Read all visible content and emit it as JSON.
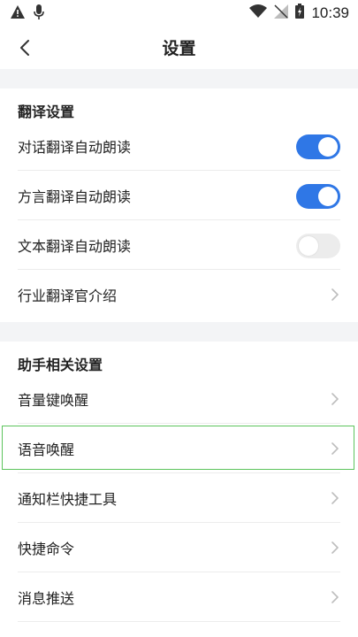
{
  "status_bar": {
    "time": "10:39",
    "icons": [
      "alert-icon",
      "mic-icon",
      "wifi-icon",
      "no-signal-icon",
      "battery-icon"
    ]
  },
  "header": {
    "title": "设置"
  },
  "translation_section": {
    "title": "翻译设置",
    "items": [
      {
        "label": "对话翻译自动朗读",
        "type": "toggle",
        "on": true
      },
      {
        "label": "方言翻译自动朗读",
        "type": "toggle",
        "on": true
      },
      {
        "label": "文本翻译自动朗读",
        "type": "toggle",
        "on": false
      },
      {
        "label": "行业翻译官介绍",
        "type": "link"
      }
    ]
  },
  "assistant_section": {
    "title": "助手相关设置",
    "items": [
      {
        "label": "音量键唤醒",
        "type": "link"
      },
      {
        "label": "语音唤醒",
        "type": "link",
        "highlighted": true
      },
      {
        "label": "通知栏快捷工具",
        "type": "link"
      },
      {
        "label": "快捷命令",
        "type": "link"
      },
      {
        "label": "消息推送",
        "type": "link"
      }
    ]
  },
  "colors": {
    "accent": "#2f77e6",
    "toggle_off": "#ececec",
    "highlight": "#5cc45c"
  }
}
